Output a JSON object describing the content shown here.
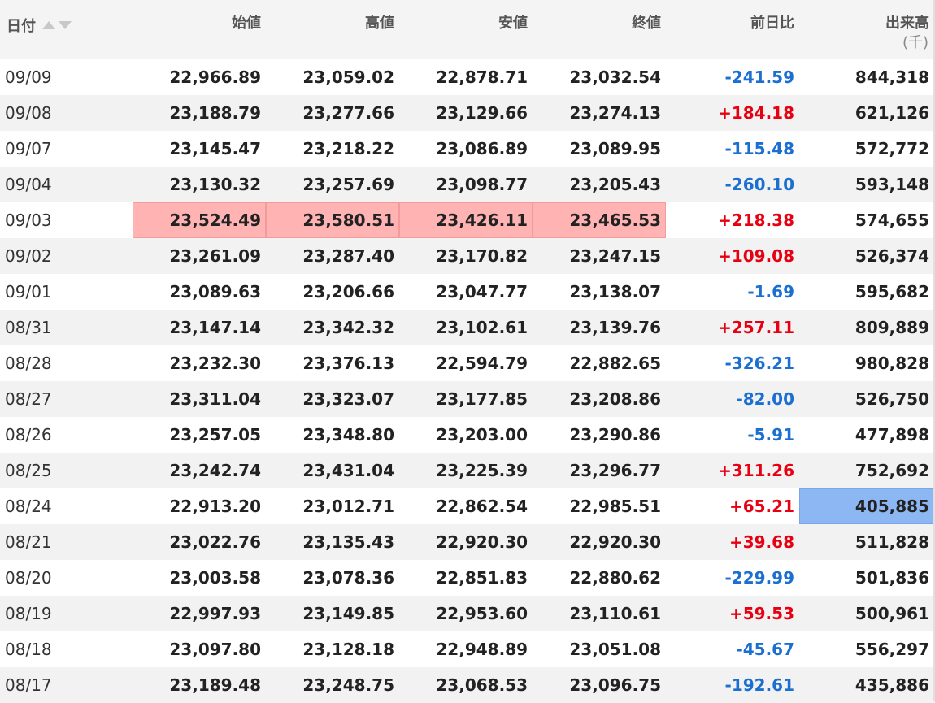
{
  "header": {
    "date": "日付",
    "open": "始値",
    "high": "高値",
    "low": "安値",
    "close": "終値",
    "change": "前日比",
    "volume": "出来高",
    "volume_unit": "(千)"
  },
  "rows": [
    {
      "date": "09/09",
      "open": "22,966.89",
      "high": "23,059.02",
      "low": "22,878.71",
      "close": "23,032.54",
      "change": "-241.59",
      "volume": "844,318"
    },
    {
      "date": "09/08",
      "open": "23,188.79",
      "high": "23,277.66",
      "low": "23,129.66",
      "close": "23,274.13",
      "change": "+184.18",
      "volume": "621,126"
    },
    {
      "date": "09/07",
      "open": "23,145.47",
      "high": "23,218.22",
      "low": "23,086.89",
      "close": "23,089.95",
      "change": "-115.48",
      "volume": "572,772"
    },
    {
      "date": "09/04",
      "open": "23,130.32",
      "high": "23,257.69",
      "low": "23,098.77",
      "close": "23,205.43",
      "change": "-260.10",
      "volume": "593,148"
    },
    {
      "date": "09/03",
      "open": "23,524.49",
      "high": "23,580.51",
      "low": "23,426.11",
      "close": "23,465.53",
      "change": "+218.38",
      "volume": "574,655"
    },
    {
      "date": "09/02",
      "open": "23,261.09",
      "high": "23,287.40",
      "low": "23,170.82",
      "close": "23,247.15",
      "change": "+109.08",
      "volume": "526,374"
    },
    {
      "date": "09/01",
      "open": "23,089.63",
      "high": "23,206.66",
      "low": "23,047.77",
      "close": "23,138.07",
      "change": "-1.69",
      "volume": "595,682"
    },
    {
      "date": "08/31",
      "open": "23,147.14",
      "high": "23,342.32",
      "low": "23,102.61",
      "close": "23,139.76",
      "change": "+257.11",
      "volume": "809,889"
    },
    {
      "date": "08/28",
      "open": "23,232.30",
      "high": "23,376.13",
      "low": "22,594.79",
      "close": "22,882.65",
      "change": "-326.21",
      "volume": "980,828"
    },
    {
      "date": "08/27",
      "open": "23,311.04",
      "high": "23,323.07",
      "low": "23,177.85",
      "close": "23,208.86",
      "change": "-82.00",
      "volume": "526,750"
    },
    {
      "date": "08/26",
      "open": "23,257.05",
      "high": "23,348.80",
      "low": "23,203.00",
      "close": "23,290.86",
      "change": "-5.91",
      "volume": "477,898"
    },
    {
      "date": "08/25",
      "open": "23,242.74",
      "high": "23,431.04",
      "low": "23,225.39",
      "close": "23,296.77",
      "change": "+311.26",
      "volume": "752,692"
    },
    {
      "date": "08/24",
      "open": "22,913.20",
      "high": "23,012.71",
      "low": "22,862.54",
      "close": "22,985.51",
      "change": "+65.21",
      "volume": "405,885"
    },
    {
      "date": "08/21",
      "open": "23,022.76",
      "high": "23,135.43",
      "low": "22,920.30",
      "close": "22,920.30",
      "change": "+39.68",
      "volume": "511,828"
    },
    {
      "date": "08/20",
      "open": "23,003.58",
      "high": "23,078.36",
      "low": "22,851.83",
      "close": "22,880.62",
      "change": "-229.99",
      "volume": "501,836"
    },
    {
      "date": "08/19",
      "open": "22,997.93",
      "high": "23,149.85",
      "low": "22,953.60",
      "close": "23,110.61",
      "change": "+59.53",
      "volume": "500,961"
    },
    {
      "date": "08/18",
      "open": "23,097.80",
      "high": "23,128.18",
      "low": "22,948.89",
      "close": "23,051.08",
      "change": "-45.67",
      "volume": "556,297"
    },
    {
      "date": "08/17",
      "open": "23,189.48",
      "high": "23,248.75",
      "low": "23,068.53",
      "close": "23,096.75",
      "change": "-192.61",
      "volume": "435,886"
    }
  ],
  "highlights": {
    "red_row_date": "09/03",
    "blue_cell_date": "08/24",
    "red_color": "#ffb3b3",
    "blue_color": "#8cb7f2",
    "positive_color": "#e60012",
    "negative_color": "#1a6fd1"
  }
}
